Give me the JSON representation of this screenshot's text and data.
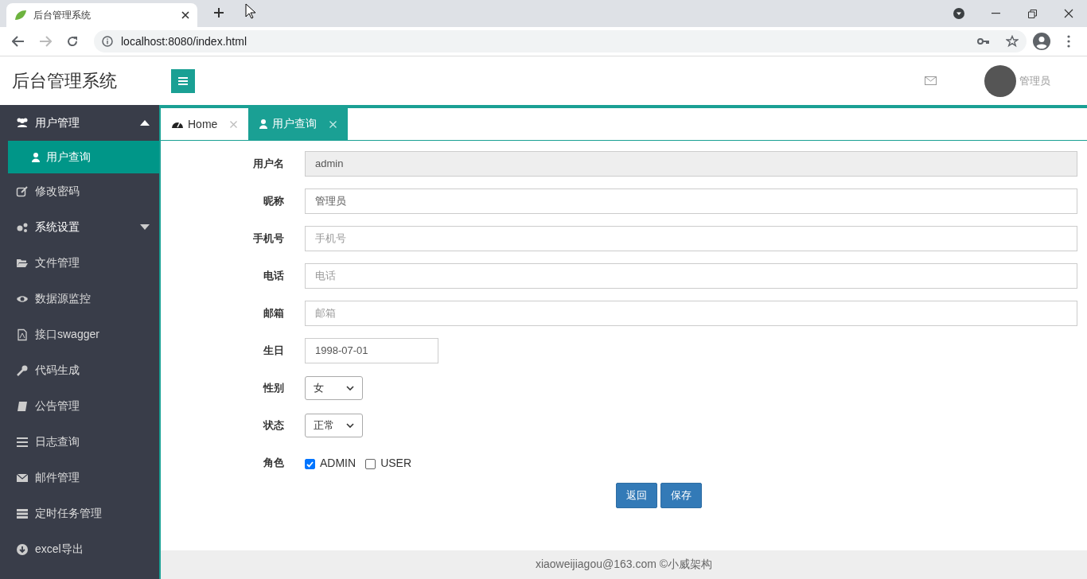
{
  "browser": {
    "tab_title": "后台管理系统",
    "url": "localhost:8080/index.html"
  },
  "header": {
    "title": "后台管理系统",
    "user_name": "管理员"
  },
  "sidebar": {
    "items": [
      {
        "kind": "group",
        "label": "用户管理",
        "expanded": true,
        "children": [
          {
            "label": "用户查询",
            "selected": true
          }
        ]
      },
      {
        "kind": "link",
        "label": "修改密码",
        "selected": false
      },
      {
        "kind": "group",
        "label": "系统设置",
        "expanded": false
      },
      {
        "kind": "link",
        "label": "文件管理",
        "selected": false
      },
      {
        "kind": "link",
        "label": "数据源监控",
        "selected": false
      },
      {
        "kind": "link",
        "label": "接口swagger",
        "selected": false
      },
      {
        "kind": "link",
        "label": "代码生成",
        "selected": false
      },
      {
        "kind": "link",
        "label": "公告管理",
        "selected": false
      },
      {
        "kind": "link",
        "label": "日志查询",
        "selected": false
      },
      {
        "kind": "link",
        "label": "邮件管理",
        "selected": false
      },
      {
        "kind": "link",
        "label": "定时任务管理",
        "selected": false
      },
      {
        "kind": "link",
        "label": "excel导出",
        "selected": false
      }
    ]
  },
  "page_tabs": [
    {
      "label": "Home",
      "selected": false
    },
    {
      "label": "用户查询",
      "selected": true
    }
  ],
  "form": {
    "fields": [
      {
        "kind": "text",
        "label": "用户名",
        "value": "admin",
        "disabled": true
      },
      {
        "kind": "text",
        "label": "昵称",
        "value": "管理员",
        "disabled": false
      },
      {
        "kind": "text",
        "label": "手机号",
        "placeholder": "手机号",
        "disabled": false
      },
      {
        "kind": "text",
        "label": "电话",
        "placeholder": "电话",
        "disabled": false
      },
      {
        "kind": "text",
        "label": "邮箱",
        "placeholder": "邮箱",
        "disabled": false
      },
      {
        "kind": "date",
        "label": "生日",
        "value": "1998-07-01"
      },
      {
        "kind": "select",
        "label": "性别",
        "value": "女"
      },
      {
        "kind": "select",
        "label": "状态",
        "value": "正常"
      },
      {
        "kind": "checkboxes",
        "label": "角色",
        "options": [
          {
            "label": "ADMIN",
            "checked": true
          },
          {
            "label": "USER",
            "checked": false
          }
        ]
      }
    ],
    "buttons": [
      "返回",
      "保存"
    ]
  },
  "footer": {
    "text": "xiaoweijiagou@163.com ©小威架构"
  }
}
